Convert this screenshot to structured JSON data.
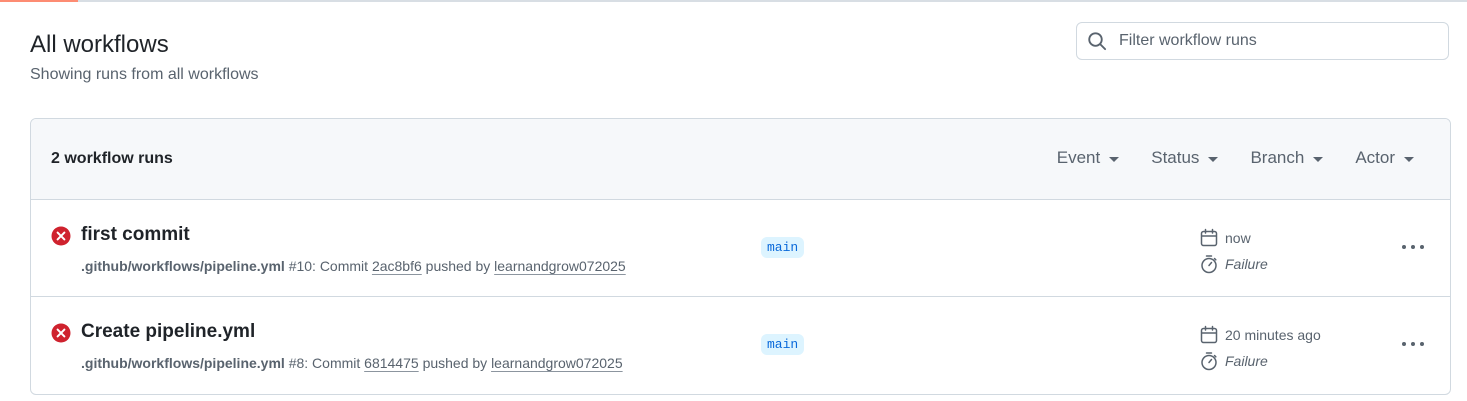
{
  "header": {
    "title": "All workflows",
    "subtitle": "Showing runs from all workflows"
  },
  "search": {
    "placeholder": "Filter workflow runs",
    "value": ""
  },
  "runs_box": {
    "count_label": "2 workflow runs",
    "filters": [
      {
        "label": "Event"
      },
      {
        "label": "Status"
      },
      {
        "label": "Branch"
      },
      {
        "label": "Actor"
      }
    ]
  },
  "runs": [
    {
      "title": "first commit",
      "workflow_file": ".github/workflows/pipeline.yml",
      "run_number": "#10",
      "commit_prefix": ": Commit",
      "commit_sha": "2ac8bf6",
      "pushed_by_text": "pushed by",
      "actor": "learnandgrow072025",
      "branch": "main",
      "time": "now",
      "result": "Failure",
      "status": "failure"
    },
    {
      "title": "Create pipeline.yml",
      "workflow_file": ".github/workflows/pipeline.yml",
      "run_number": "#8",
      "commit_prefix": ": Commit",
      "commit_sha": "6814475",
      "pushed_by_text": "pushed by",
      "actor": "learnandgrow072025",
      "branch": "main",
      "time": "20 minutes ago",
      "result": "Failure",
      "status": "failure"
    }
  ],
  "icons": {
    "search": "search-icon",
    "status_failure": "x-circle-fill-icon",
    "calendar": "calendar-icon",
    "stopwatch": "stopwatch-icon",
    "more": "kebab-horizontal-icon",
    "caret": "triangle-down-icon"
  },
  "colors": {
    "failure": "#cf222e",
    "branch_text": "#0969da",
    "branch_bg": "#ddf4ff",
    "tab_accent": "#fd8c73"
  }
}
